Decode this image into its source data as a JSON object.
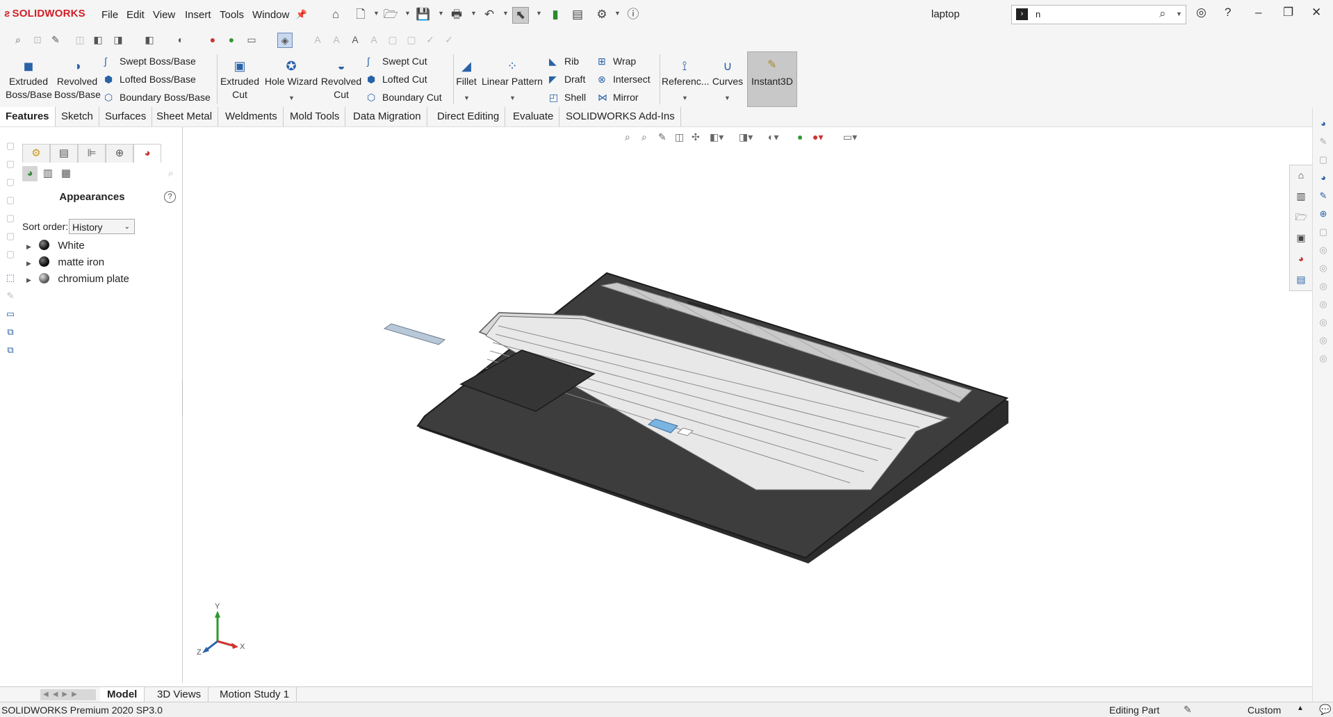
{
  "app": {
    "logo": "SOLIDWORKS",
    "menus": [
      "File",
      "Edit",
      "View",
      "Insert",
      "Tools",
      "Window"
    ],
    "document_title": "laptop",
    "search": {
      "value": "n"
    }
  },
  "ribbon": {
    "extruded_boss": "Extruded Boss/Base",
    "revolved_boss": "Revolved Boss/Base",
    "swept_boss": "Swept Boss/Base",
    "lofted_boss": "Lofted Boss/Base",
    "boundary_boss": "Boundary Boss/Base",
    "extruded_cut": "Extruded Cut",
    "hole_wizard": "Hole Wizard",
    "revolved_cut": "Revolved Cut",
    "swept_cut": "Swept Cut",
    "lofted_cut": "Lofted Cut",
    "boundary_cut": "Boundary Cut",
    "fillet": "Fillet",
    "linear_pattern": "Linear Pattern",
    "rib": "Rib",
    "draft": "Draft",
    "shell": "Shell",
    "wrap": "Wrap",
    "intersect": "Intersect",
    "mirror": "Mirror",
    "reference": "Referenc...",
    "curves": "Curves",
    "instant3d": "Instant3D"
  },
  "command_tabs": [
    "Features",
    "Sketch",
    "Surfaces",
    "Sheet Metal",
    "Weldments",
    "Mold Tools",
    "Data Migration",
    "Direct Editing",
    "Evaluate",
    "SOLIDWORKS Add-Ins"
  ],
  "panel": {
    "title": "Appearances",
    "sort_label": "Sort order:",
    "sort_value": "History",
    "items": [
      {
        "label": "White",
        "color": "#222222"
      },
      {
        "label": "matte iron",
        "color": "#1a1a1a"
      },
      {
        "label": "chromium plate",
        "color": "#6a6a6a"
      }
    ]
  },
  "triad": {
    "x": "X",
    "y": "Y",
    "z": "Z"
  },
  "bottom_tabs": [
    "Model",
    "3D Views",
    "Motion Study 1"
  ],
  "status": {
    "product": "SOLIDWORKS Premium 2020 SP3.0",
    "mode": "Editing Part",
    "units": "Custom"
  },
  "colors": {
    "accent": "#2a62a8",
    "brand": "#d11f26",
    "laptop_body": "#3a3a3a"
  }
}
